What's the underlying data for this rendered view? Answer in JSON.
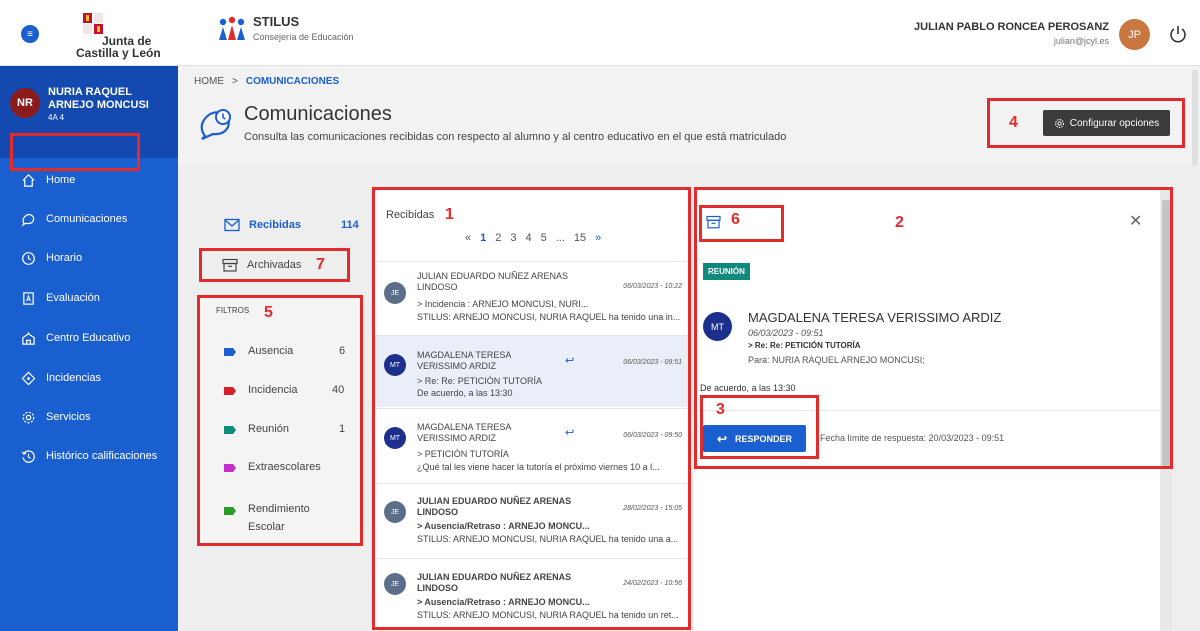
{
  "topbar": {
    "jcyl_line1": "Junta de",
    "jcyl_line2": "Castilla y León",
    "app_name": "STILUS",
    "app_subtitle": "Consejería de Educación",
    "user_name": "JULIAN PABLO RONCEA PEROSANZ",
    "user_email": "julian@jcyl.es",
    "user_initials": "JP"
  },
  "sidebar": {
    "student_initials": "NR",
    "student_name": "NURIA RAQUEL ARNEJO MONCUSI",
    "student_group": "4A 4",
    "items": [
      {
        "label": "Home",
        "icon": "home-icon"
      },
      {
        "label": "Comunicaciones",
        "icon": "chat-icon"
      },
      {
        "label": "Horario",
        "icon": "clock-icon"
      },
      {
        "label": "Evaluación",
        "icon": "grade-icon"
      },
      {
        "label": "Centro Educativo",
        "icon": "school-icon"
      },
      {
        "label": "Incidencias",
        "icon": "warning-icon"
      },
      {
        "label": "Servicios",
        "icon": "gear-icon"
      },
      {
        "label": "Histórico calificaciones",
        "icon": "history-icon"
      }
    ]
  },
  "header": {
    "breadcrumb_home": "HOME",
    "breadcrumb_sep": ">",
    "breadcrumb_current": "COMUNICACIONES",
    "title": "Comunicaciones",
    "description": "Consulta las comunicaciones recibidas con respecto al alumno y al centro educativo en el que está matriculado",
    "config_button": "Configurar opciones"
  },
  "folders": {
    "received_label": "Recibidas",
    "received_count": "114",
    "archived_label": "Archivadas"
  },
  "filters": {
    "title": "FILTROS",
    "items": [
      {
        "label": "Ausencia",
        "count": "6",
        "color": "#1a5fd0"
      },
      {
        "label": "Incidencia",
        "count": "40",
        "color": "#d41f2b"
      },
      {
        "label": "Reunión",
        "count": "1",
        "color": "#0f8a7c"
      },
      {
        "label": "Extraescolares",
        "count": "",
        "color": "#c22fc9"
      },
      {
        "label": "Rendimiento Escolar",
        "count": "",
        "color": "#2a9a2a"
      }
    ]
  },
  "list": {
    "title": "Recibidas",
    "pager": [
      "«",
      "1",
      "2",
      "3",
      "4",
      "5",
      "...",
      "15",
      "»"
    ],
    "messages": [
      {
        "initials": "JE",
        "sender": "JULIAN EDUARDO NUÑEZ ARENAS LINDOSO",
        "date": "06/03/2023 - 10:22",
        "subject": "> Incidencia : ARNEJO MONCUSI, NURI...",
        "preview": "STILUS: ARNEJO MONCUSI, NURIA RAQUEL ha tenido una in..."
      },
      {
        "initials": "MT",
        "sender": "MAGDALENA TERESA VERISSIMO ARDIZ",
        "date": "06/03/2023 - 09:51",
        "subject": "> Re: Re: PETICIÓN TUTORÍA",
        "preview": "De acuerdo, a las 13:30"
      },
      {
        "initials": "MT",
        "sender": "MAGDALENA TERESA VERISSIMO ARDIZ",
        "date": "06/03/2023 - 09:50",
        "subject": "> PETICIÓN TUTORÍA",
        "preview": "¿Qué tal les viene hacer la tutoría el próximo viernes 10 a l..."
      },
      {
        "initials": "JE",
        "sender": "JULIAN EDUARDO NUÑEZ ARENAS LINDOSO",
        "date": "28/02/2023 - 15:05",
        "subject": "> Ausencia/Retraso : ARNEJO MONCU...",
        "preview": "STILUS: ARNEJO MONCUSI, NURIA RAQUEL ha tenido una a..."
      },
      {
        "initials": "JE",
        "sender": "JULIAN EDUARDO NUÑEZ ARENAS LINDOSO",
        "date": "24/02/2023 - 10:56",
        "subject": "> Ausencia/Retraso : ARNEJO MONCU...",
        "preview": "STILUS: ARNEJO MONCUSI, NURIA RAQUEL ha tenido un ret..."
      }
    ]
  },
  "detail": {
    "badge": "REUNIÓN",
    "initials": "MT",
    "sender": "MAGDALENA TERESA VERISSIMO ARDIZ",
    "date": "06/03/2023 - 09:51",
    "subject": "> Re: Re: PETICIÓN TUTORÍA",
    "to": "Para: NURIA RAQUEL ARNEJO MONCUSI;",
    "body": "De acuerdo, a las 13:30",
    "reply_button": "RESPONDER",
    "deadline": "Fecha límite de respuesta: 20/03/2023 - 09:51"
  },
  "annotations": [
    "1",
    "2",
    "3",
    "4",
    "5",
    "6",
    "7"
  ]
}
